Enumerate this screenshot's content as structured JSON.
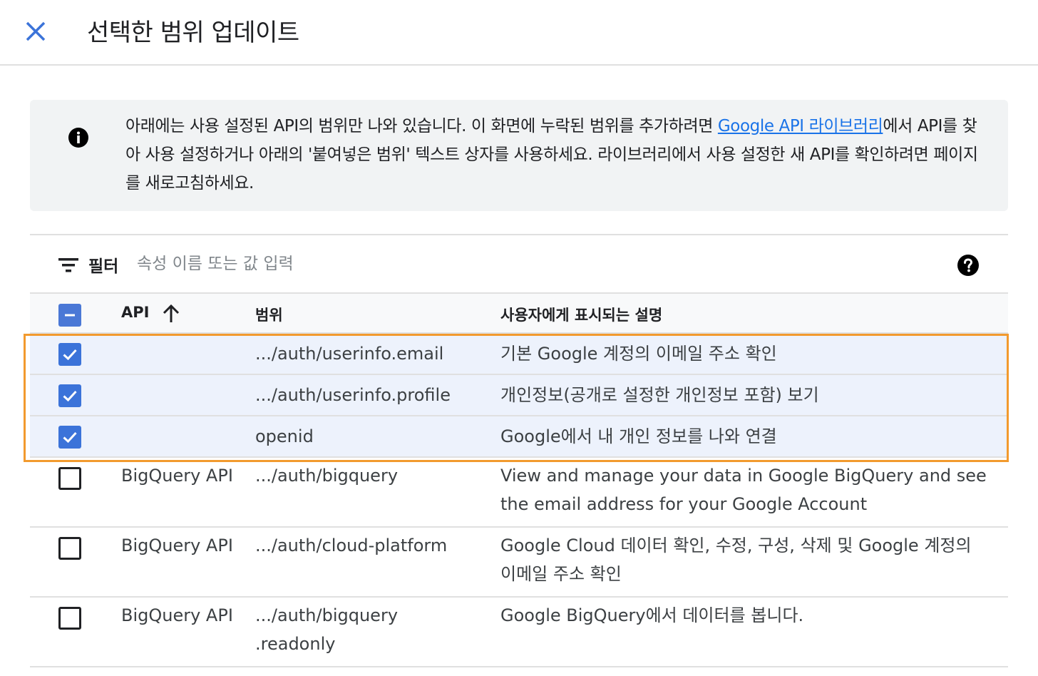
{
  "header": {
    "title": "선택한 범위 업데이트"
  },
  "info": {
    "text_before_link": "아래에는 사용 설정된 API의 범위만 나와 있습니다. 이 화면에 누락된 범위를 추가하려면 ",
    "link_text": "Google API 라이브러리",
    "text_after_link": "에서 API를 찾아 사용 설정하거나 아래의 '붙여넣은 범위' 텍스트 상자를 사용하세요. 라이브러리에서 사용 설정한 새 API를 확인하려면 페이지를 새로고침하세요."
  },
  "filter": {
    "label": "필터",
    "placeholder": "속성 이름 또는 값 입력"
  },
  "table": {
    "columns": {
      "api": "API",
      "scope": "범위",
      "description": "사용자에게 표시되는 설명"
    },
    "header_checkbox_state": "indeterminate",
    "rows": [
      {
        "checked": true,
        "api": "",
        "scope": ".../auth/userinfo.email",
        "description": "기본 Google 계정의 이메일 주소 확인"
      },
      {
        "checked": true,
        "api": "",
        "scope": ".../auth/userinfo.profile",
        "description": "개인정보(공개로 설정한 개인정보 포함) 보기"
      },
      {
        "checked": true,
        "api": "",
        "scope": "openid",
        "description": "Google에서 내 개인 정보를 나와 연결"
      },
      {
        "checked": false,
        "api": "BigQuery API",
        "scope": ".../auth/bigquery",
        "description": "View and manage your data in Google BigQuery and see the email address for your Google Account"
      },
      {
        "checked": false,
        "api": "BigQuery API",
        "scope": ".../auth/cloud-platform",
        "description": "Google Cloud 데이터 확인, 수정, 구성, 삭제 및 Google 계정의 이메일 주소 확인"
      },
      {
        "checked": false,
        "api": "BigQuery API",
        "scope": ".../auth/bigquery .readonly",
        "description": "Google BigQuery에서 데이터를 봅니다."
      }
    ]
  },
  "colors": {
    "accent": "#1a73e8",
    "highlight": "#f29a2e",
    "selected_row": "#edf2fc"
  }
}
